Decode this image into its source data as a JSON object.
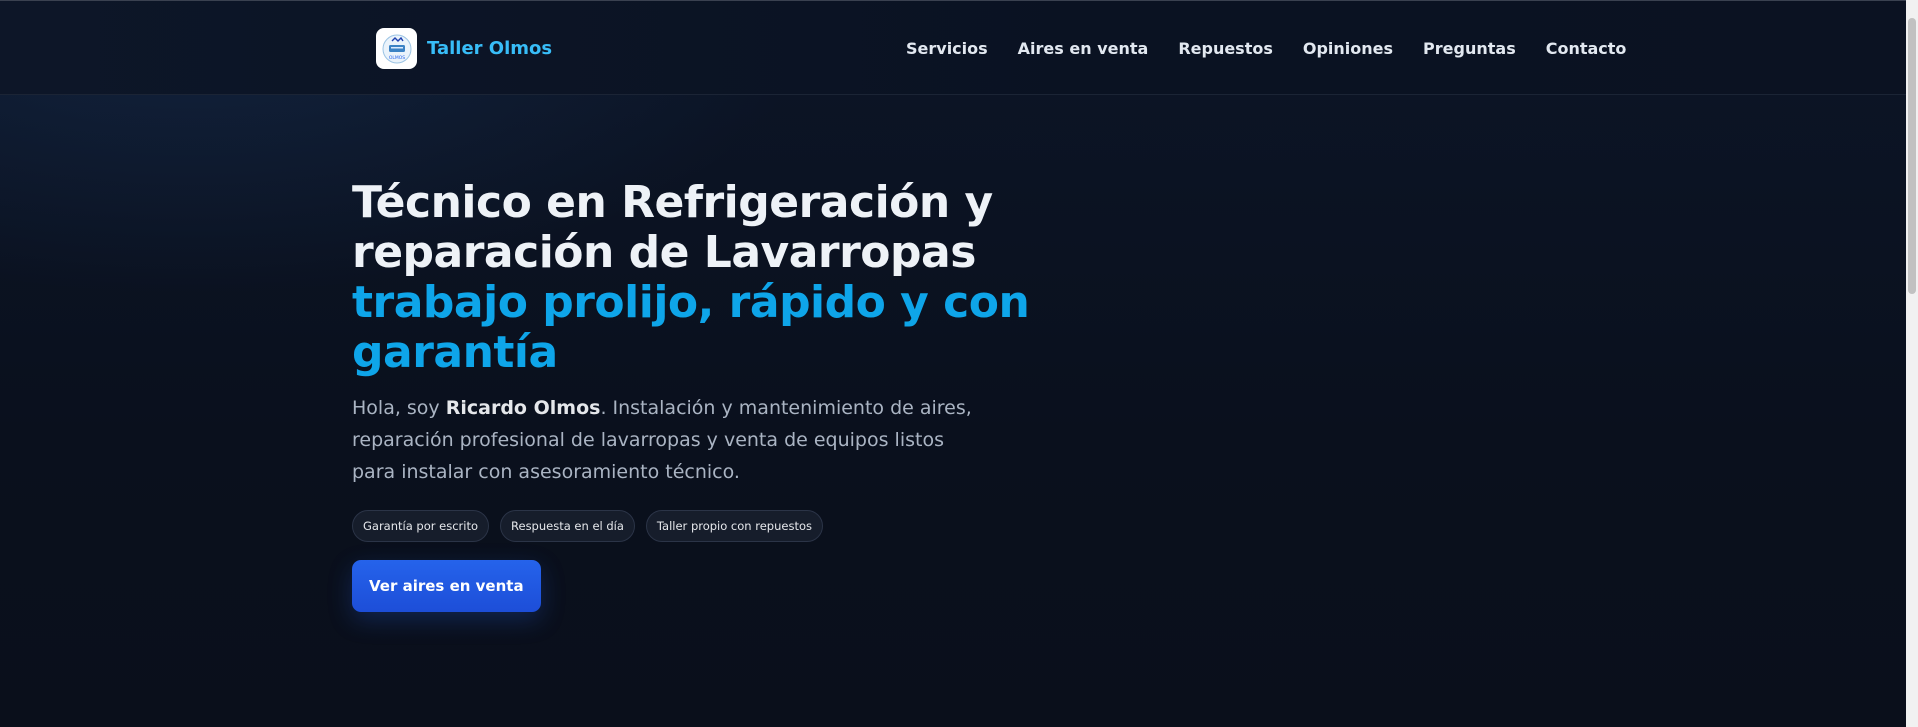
{
  "header": {
    "brand_name": "Taller Olmos",
    "nav": [
      "Servicios",
      "Aires en venta",
      "Repuestos",
      "Opiniones",
      "Preguntas",
      "Contacto"
    ]
  },
  "hero": {
    "title_line1": "Técnico en Refrigeración y",
    "title_line2": "reparación de Lavarropas",
    "title_accent": "trabajo prolijo, rápido y con garantía",
    "sub_pre": "Hola, soy ",
    "sub_name": "Ricardo Olmos",
    "sub_post": ". Instalación y mantenimiento de aires, reparación profesional de lavarropas y venta de equipos listos para instalar con asesoramiento técnico.",
    "badges": [
      "Garantía por escrito",
      "Respuesta en el día",
      "Taller propio con repuestos"
    ],
    "cta_label": "Ver aires en venta"
  },
  "colors": {
    "accent": "#0ea5e9",
    "brand": "#38bdf8",
    "button": "#2563eb",
    "background": "#0b1120"
  },
  "icons": {
    "logo": "taller-olmos-logo-icon"
  }
}
